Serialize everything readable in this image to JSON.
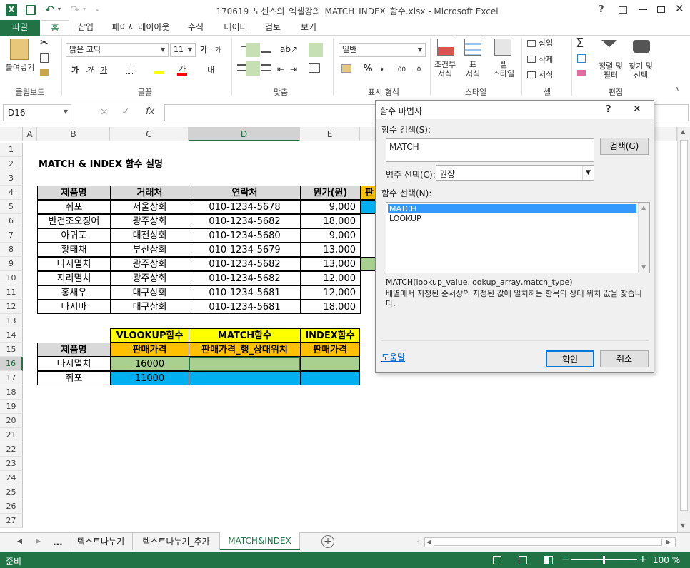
{
  "title": {
    "filename": "170619_노센스의_엑셀강의_MATCH_INDEX_함수.xlsx - Microsoft Excel",
    "help": "?"
  },
  "tabs": {
    "file": "파일",
    "items": [
      "홈",
      "삽입",
      "페이지 레이아웃",
      "수식",
      "데이터",
      "검토",
      "보기"
    ]
  },
  "ribbon": {
    "paste": "붙여넣기",
    "clipboard": "클립보드",
    "font_name": "맑은 고딕",
    "font_size": "11",
    "font_group": "글꼴",
    "align_group": "맞춤",
    "number_format": "일반",
    "number_group": "표시 형식",
    "cond_format": "조건부",
    "cond_format2": "서식",
    "table1": "표",
    "table2": "서식",
    "cellstyle1": "셀",
    "cellstyle2": "스타일",
    "style_group": "스타일",
    "insert": "삽입",
    "delete": "삭제",
    "format": "서식",
    "cells_group": "셀",
    "sort1": "정렬 및",
    "sort2": "필터",
    "find1": "찾기 및",
    "find2": "선택",
    "edit_group": "편집",
    "inc_font": "가",
    "dec_font": "가",
    "bold": "가",
    "italic": "가",
    "underline": "가",
    "font_color": "가",
    "wrap": "내",
    "percent": "%",
    "comma": ",",
    "dec_inc": ".00",
    "dec_dec": ".0"
  },
  "formula_bar": {
    "namebox": "D16",
    "fx": "fx",
    "cancel": "×",
    "enter": "✓"
  },
  "columns": [
    "A",
    "B",
    "C",
    "D",
    "E"
  ],
  "rows": [
    "1",
    "2",
    "3",
    "4",
    "5",
    "6",
    "7",
    "8",
    "9",
    "10",
    "11",
    "12",
    "13",
    "14",
    "15",
    "16",
    "17",
    "18",
    "19",
    "20",
    "21",
    "22",
    "23",
    "24",
    "25",
    "26",
    "27"
  ],
  "sheet": {
    "heading": "MATCH & INDEX 함수 설명",
    "header": [
      "제품명",
      "거래처",
      "연락처",
      "원가(원)",
      "판"
    ],
    "data": [
      [
        "쥐포",
        "서울상회",
        "010-1234-5678",
        "9,000"
      ],
      [
        "반건조오징어",
        "광주상회",
        "010-1234-5682",
        "18,000"
      ],
      [
        "아귀포",
        "대전상회",
        "010-1234-5680",
        "9,000"
      ],
      [
        "황태채",
        "부산상회",
        "010-1234-5679",
        "13,000"
      ],
      [
        "다시멸치",
        "광주상회",
        "010-1234-5682",
        "13,000"
      ],
      [
        "지리멸치",
        "광주상회",
        "010-1234-5682",
        "12,000"
      ],
      [
        "홍새우",
        "대구상회",
        "010-1234-5681",
        "12,000"
      ],
      [
        "다시마",
        "대구상회",
        "010-1234-5681",
        "18,000"
      ]
    ],
    "lookup_titles": [
      "VLOOKUP함수",
      "MATCH함수",
      "INDEX함수"
    ],
    "lookup_header": [
      "제품명",
      "판매가격",
      "판매가격_행_상대위치",
      "판매가격"
    ],
    "lookup_rows": [
      [
        "다시멸치",
        "16000"
      ],
      [
        "쥐포",
        "11000"
      ]
    ]
  },
  "dialog": {
    "title": "함수 마법사",
    "help": "?",
    "close": "✕",
    "search_label": "함수 검색(S):",
    "search_value": "MATCH",
    "search_button": "검색(G)",
    "category_label": "범주 선택(C):",
    "category_value": "권장",
    "func_label": "함수 선택(N):",
    "functions": [
      "MATCH",
      "LOOKUP"
    ],
    "signature": "MATCH(lookup_value,lookup_array,match_type)",
    "description": "배열에서 지정된 순서상의 지정된 값에 일치하는 항목의 상대 위치 값을 찾습니다.",
    "help_link": "도움말",
    "ok": "확인",
    "cancel": "취소"
  },
  "sheet_tabs": {
    "more": "...",
    "tabs": [
      "텍스트나누기",
      "텍스트나누기_추가",
      "MATCH&INDEX"
    ],
    "add": "+"
  },
  "status": {
    "ready": "준비",
    "zoom": "100 %",
    "minus": "−",
    "plus": "+"
  },
  "colors": {
    "excel_green": "#217346",
    "header_orange": "#ffc000",
    "yellow": "#ffff00",
    "blue": "#00b0f0",
    "green_fill": "#a9d08e"
  }
}
